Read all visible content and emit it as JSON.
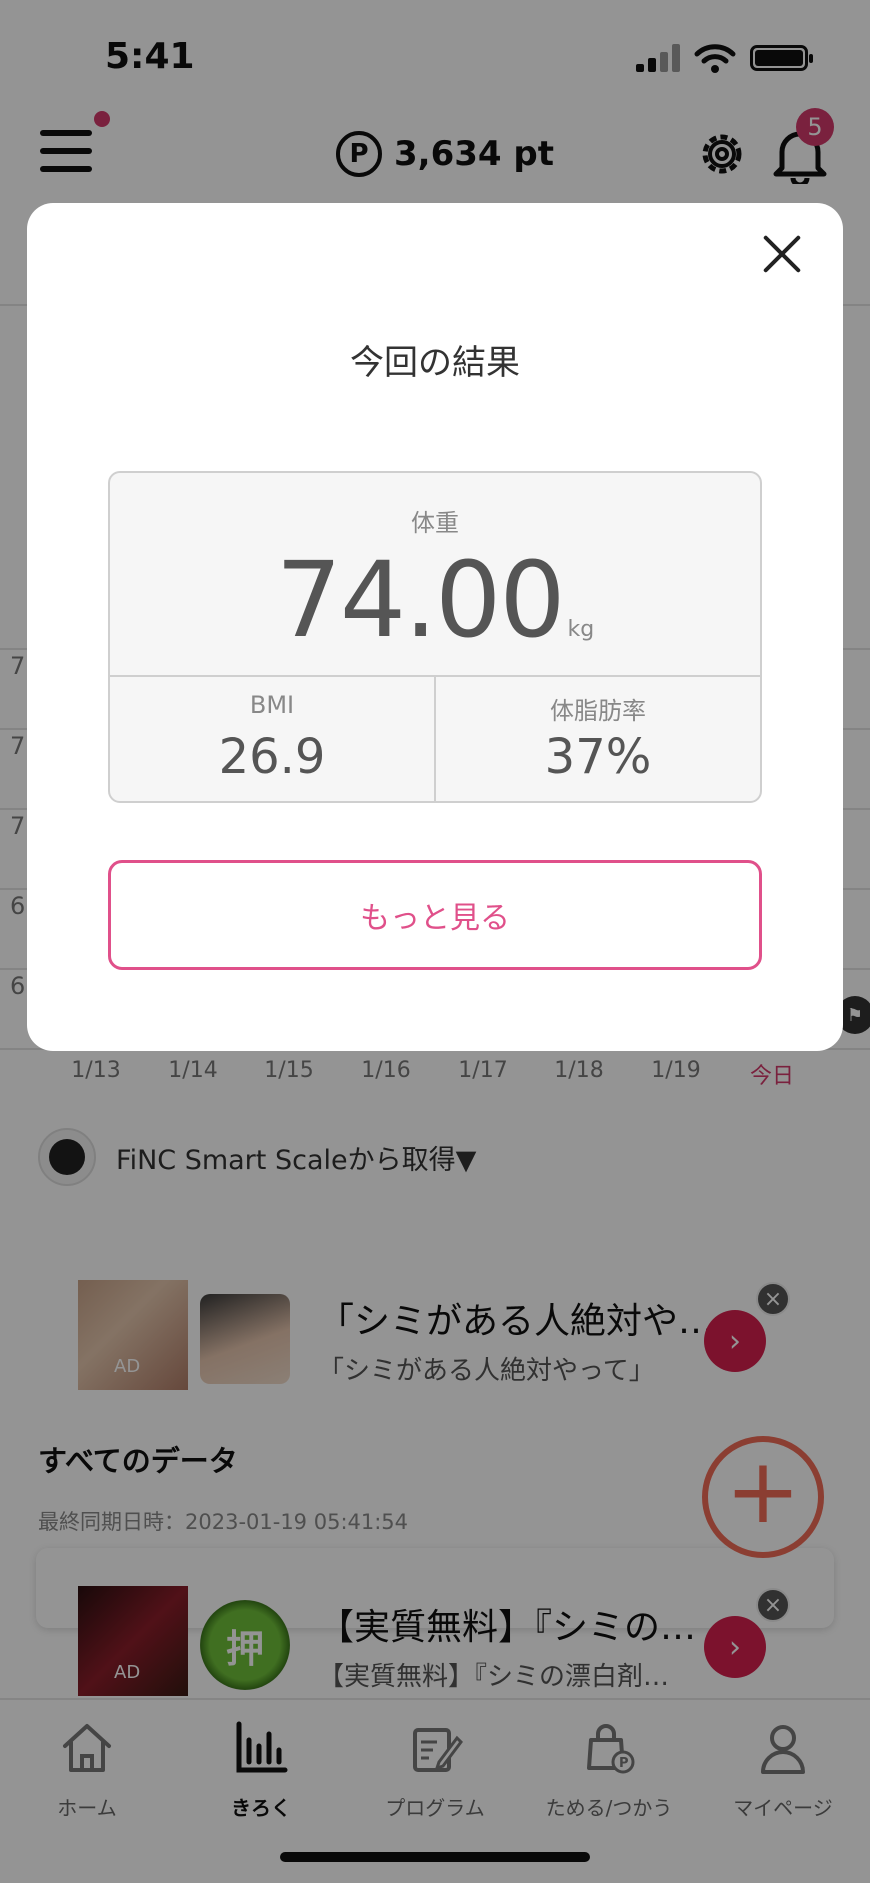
{
  "status_bar": {
    "time": "5:41"
  },
  "header": {
    "points": "3,634 pt",
    "points_icon": "P",
    "notification_count": "5"
  },
  "chart": {
    "y_ticks": [
      "7",
      "7",
      "7",
      "6",
      "6"
    ],
    "x_ticks": [
      "1/13",
      "1/14",
      "1/15",
      "1/16",
      "1/17",
      "1/18",
      "1/19",
      "今日"
    ]
  },
  "source": {
    "text": "FiNC Smart Scaleから取得▼"
  },
  "ads": [
    {
      "title": "「シミがある人絶対や…",
      "subtitle": "「シミがある人絶対やって」",
      "label": "AD"
    },
    {
      "title": "【実質無料】『シミの…",
      "subtitle": "【実質無料】『シミの漂白剤…",
      "label": "AD",
      "stamp": "押"
    }
  ],
  "all_data": {
    "title": "すべてのデータ",
    "last_sync": "最終同期日時：2023-01-19 05:41:54"
  },
  "tabs": [
    {
      "label": "ホーム",
      "icon": "home-icon"
    },
    {
      "label": "きろく",
      "icon": "bar-chart-icon",
      "active": true
    },
    {
      "label": "プログラム",
      "icon": "program-icon"
    },
    {
      "label": "ためる/つかう",
      "icon": "shopping-bag-icon"
    },
    {
      "label": "マイページ",
      "icon": "person-icon"
    }
  ],
  "modal": {
    "title": "今回の結果",
    "weight_label": "体重",
    "weight_value": "74.00",
    "weight_unit": "kg",
    "bmi_label": "BMI",
    "bmi_value": "26.9",
    "fat_label": "体脂肪率",
    "fat_value": "37%",
    "more_button": "もっと見る"
  },
  "colors": {
    "accent": "#e0508a",
    "badge": "#d33a6b",
    "fab": "#f06b57",
    "ad_button": "#d6204e"
  }
}
